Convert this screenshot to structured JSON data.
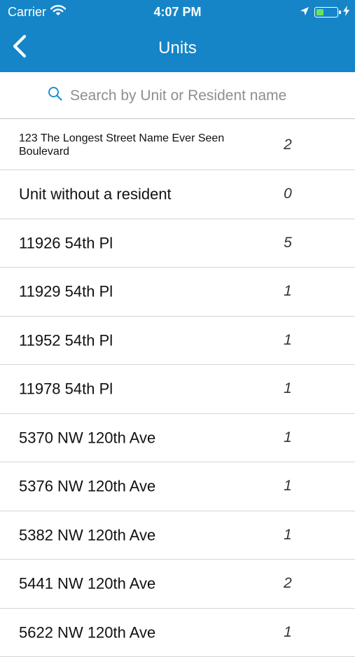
{
  "status_bar": {
    "carrier": "Carrier",
    "time": "4:07 PM",
    "icons": [
      "wifi-icon",
      "location-arrow-icon",
      "battery-icon",
      "charging-bolt-icon"
    ],
    "battery_level": 0.35,
    "battery_color": "#6be25c"
  },
  "nav": {
    "title": "Units",
    "back_icon": "chevron-left-icon",
    "background_color": "#1585c8"
  },
  "search": {
    "icon": "search-icon",
    "value": "",
    "placeholder": "Search by Unit or Resident name"
  },
  "units": [
    {
      "name": "123 The Longest Street Name Ever Seen Boulevard",
      "count": "2"
    },
    {
      "name": "Unit without a resident",
      "count": "0"
    },
    {
      "name": "11926 54th Pl",
      "count": "5"
    },
    {
      "name": "11929 54th Pl",
      "count": "1"
    },
    {
      "name": "11952 54th Pl",
      "count": "1"
    },
    {
      "name": "11978 54th Pl",
      "count": "1"
    },
    {
      "name": "5370 NW 120th Ave",
      "count": "1"
    },
    {
      "name": "5376 NW 120th Ave",
      "count": "1"
    },
    {
      "name": "5382 NW 120th Ave",
      "count": "1"
    },
    {
      "name": "5441 NW 120th Ave",
      "count": "2"
    },
    {
      "name": "5622 NW 120th Ave",
      "count": "1"
    }
  ]
}
